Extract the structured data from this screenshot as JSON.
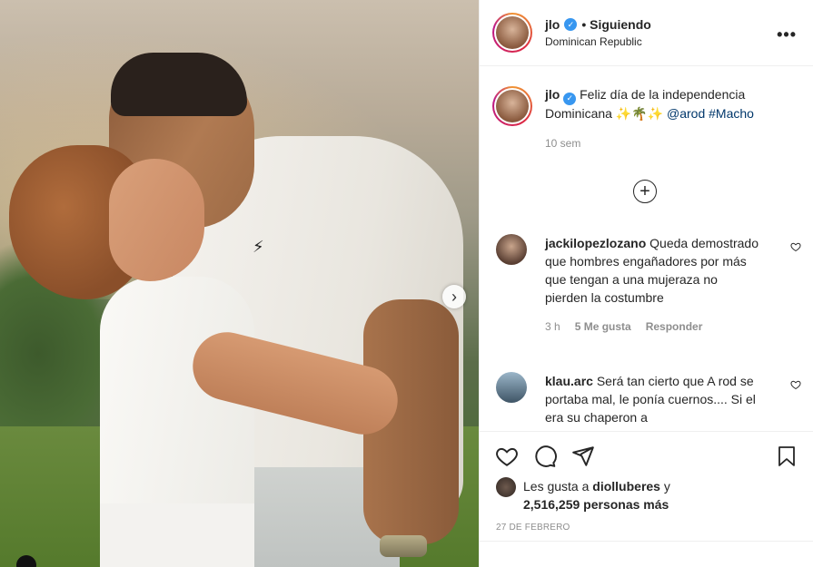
{
  "post": {
    "username": "jlo",
    "verified_mark": "✓",
    "follow_status": "• Siguiendo",
    "location": "Dominican Republic",
    "more_label": "•••",
    "caption_text": "Feliz día de la independencia Dominicana",
    "caption_emojis": "✨🌴✨",
    "caption_mention": "@arod",
    "caption_hashtag": "#Macho",
    "caption_time": "10 sem",
    "load_more": "+"
  },
  "photo": {
    "carousel_next": "›"
  },
  "comments": [
    {
      "user": "jackilopezlozano",
      "text": "Queda demostrado que hombres engañadores por más que tengan a una mujeraza no pierden la costumbre",
      "time": "3 h",
      "likes": "5 Me gusta",
      "reply": "Responder"
    },
    {
      "user": "klau.arc",
      "text": "Será tan cierto que A rod se portaba mal, le ponía cuernos.... Si el era su chaperon a"
    }
  ],
  "likes": {
    "prefix": "Les gusta a ",
    "user": "diolluberes",
    "mid": " y",
    "count": "2,516,259 personas más"
  },
  "date": "27 DE FEBRERO",
  "colors": {
    "link": "#00376b",
    "verified": "#3897f0",
    "muted": "#8e8e8e"
  }
}
